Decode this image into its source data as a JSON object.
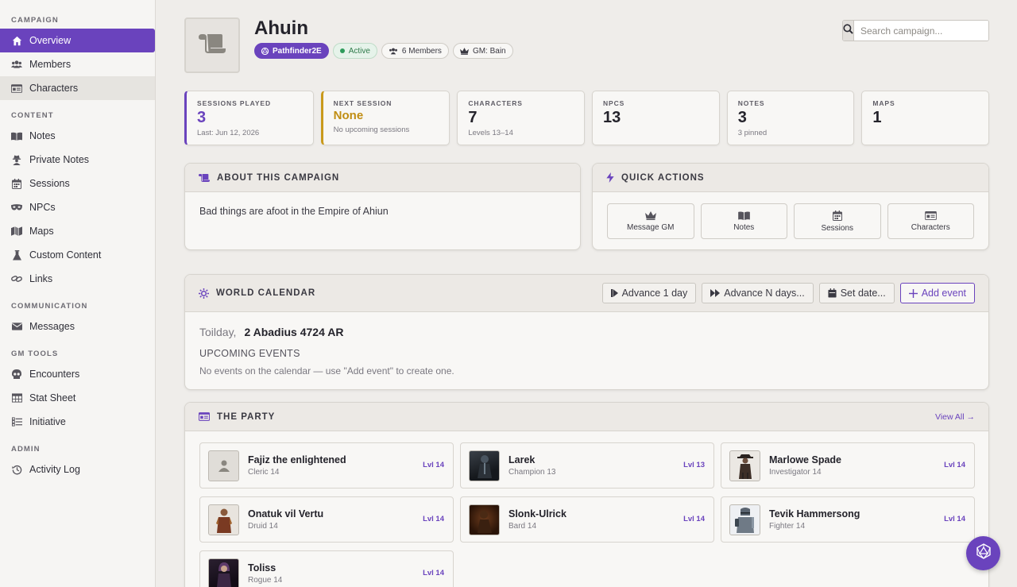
{
  "sidebar": {
    "sections": [
      {
        "title": "CAMPAIGN"
      },
      {
        "title": "CONTENT"
      },
      {
        "title": "COMMUNICATION"
      },
      {
        "title": "GM TOOLS"
      },
      {
        "title": "ADMIN"
      }
    ],
    "items": [
      {
        "label": "Overview",
        "icon": "home-icon"
      },
      {
        "label": "Members",
        "icon": "users-icon"
      },
      {
        "label": "Characters",
        "icon": "id-card-icon"
      },
      {
        "label": "Notes",
        "icon": "book-icon"
      },
      {
        "label": "Private Notes",
        "icon": "user-secret-icon"
      },
      {
        "label": "Sessions",
        "icon": "calendar-icon"
      },
      {
        "label": "NPCs",
        "icon": "mask-icon"
      },
      {
        "label": "Maps",
        "icon": "map-icon"
      },
      {
        "label": "Custom Content",
        "icon": "flask-icon"
      },
      {
        "label": "Links",
        "icon": "link-icon"
      },
      {
        "label": "Messages",
        "icon": "envelope-icon"
      },
      {
        "label": "Encounters",
        "icon": "skull-icon"
      },
      {
        "label": "Stat Sheet",
        "icon": "table-icon"
      },
      {
        "label": "Initiative",
        "icon": "list-icon"
      },
      {
        "label": "Activity Log",
        "icon": "history-icon"
      }
    ]
  },
  "campaign": {
    "title": "Ahuin",
    "system_badge": "Pathfinder2E",
    "status_badge": "Active",
    "members_badge": "6 Members",
    "gm_badge": "GM: Bain"
  },
  "search": {
    "placeholder": "Search campaign..."
  },
  "stats": [
    {
      "label": "SESSIONS PLAYED",
      "value": "3",
      "sub": "Last: Jun 12, 2026"
    },
    {
      "label": "NEXT SESSION",
      "value": "None",
      "sub": "No upcoming sessions"
    },
    {
      "label": "CHARACTERS",
      "value": "7",
      "sub": "Levels 13–14"
    },
    {
      "label": "NPCS",
      "value": "13",
      "sub": ""
    },
    {
      "label": "NOTES",
      "value": "3",
      "sub": "3 pinned"
    },
    {
      "label": "MAPS",
      "value": "1",
      "sub": ""
    }
  ],
  "about": {
    "title": "ABOUT THIS CAMPAIGN",
    "text": "Bad things are afoot in the Empire of Ahiun"
  },
  "quick_actions": {
    "title": "QUICK ACTIONS",
    "buttons": [
      "Message GM",
      "Notes",
      "Sessions",
      "Characters"
    ]
  },
  "calendar": {
    "title": "WORLD CALENDAR",
    "buttons": [
      "Advance 1 day",
      "Advance N days...",
      "Set date...",
      "Add event"
    ],
    "weekday": "Toilday,",
    "date": "2 Abadius 4724 AR",
    "upcoming_label": "UPCOMING EVENTS",
    "empty_text": "No events on the calendar — use \"Add event\" to create one."
  },
  "party": {
    "title": "THE PARTY",
    "view_all": "View All →",
    "members": [
      {
        "name": "Fajiz the enlightened",
        "class": "Cleric 14",
        "level": "Lvl 14"
      },
      {
        "name": "Larek",
        "class": "Champion 13",
        "level": "Lvl 13"
      },
      {
        "name": "Marlowe Spade",
        "class": "Investigator 14",
        "level": "Lvl 14"
      },
      {
        "name": "Onatuk vil Vertu",
        "class": "Druid 14",
        "level": "Lvl 14"
      },
      {
        "name": "Slonk-Ulrick",
        "class": "Bard 14",
        "level": "Lvl 14"
      },
      {
        "name": "Tevik Hammersong",
        "class": "Fighter 14",
        "level": "Lvl 14"
      },
      {
        "name": "Toliss",
        "class": "Rogue 14",
        "level": "Lvl 14"
      }
    ]
  },
  "colors": {
    "accent": "#6a43bd",
    "gold": "#c08d12",
    "active_green": "#2f9b5b"
  }
}
